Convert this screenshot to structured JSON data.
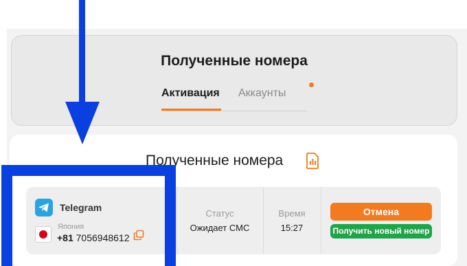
{
  "header": {
    "title": "Полученные номера",
    "tabs": [
      {
        "label": "Активация",
        "active": true
      },
      {
        "label": "Аккаунты",
        "active": false
      }
    ]
  },
  "content": {
    "title": "Полученные номера",
    "row": {
      "service": "Telegram",
      "country": "Япония",
      "phone_code": "+81",
      "phone_number": "7056948612",
      "status_label": "Статус",
      "status_value": "Ожидает СМС",
      "time_label": "Время",
      "time_value": "15:27",
      "cancel_label": "Отмена",
      "new_number_label": "Получить новый номер"
    }
  },
  "icons": {
    "service": "telegram-icon",
    "flag": "japan-flag-icon",
    "copy": "copy-icon",
    "sim": "sim-card-icon"
  },
  "colors": {
    "accent": "#f47a1f",
    "success": "#1fa44a",
    "telegram": "#2aa3e0",
    "annotation": "#0a3fe0"
  }
}
